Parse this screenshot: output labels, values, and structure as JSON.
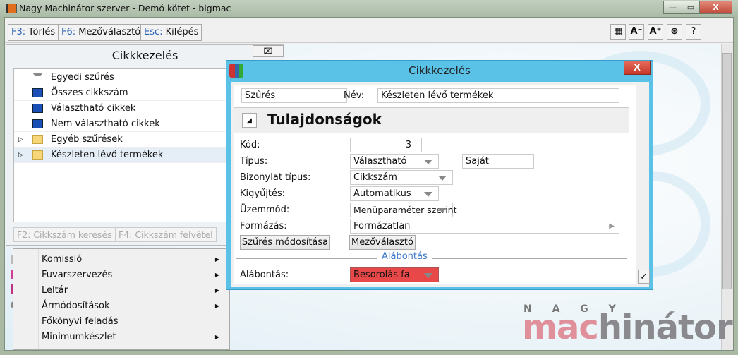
{
  "window": {
    "title": "Nagy Machinátor szerver - Demó kötet - bigmac",
    "minimize": "—",
    "maximize": "▭",
    "close": "X"
  },
  "toolbar": {
    "buttons": [
      {
        "key": "F3:",
        "label": " Törlés"
      },
      {
        "key": "F6:",
        "label": " Mezőválasztó"
      },
      {
        "key": "Esc:",
        "label": " Kilépés"
      }
    ],
    "icons": {
      "grid": "▦",
      "font_smaller": "A⁻",
      "font_larger": "A⁺",
      "lifebuoy": "⊕",
      "help": "?"
    }
  },
  "left_panel": {
    "title": "Cikkkezelés",
    "close": "⌧",
    "items": [
      {
        "label": "Egyedi szűrés",
        "icon": "filter-icon"
      },
      {
        "label": "Összes cikkszám",
        "icon": "monitor-icon"
      },
      {
        "label": "Választható cikkek",
        "icon": "monitor-icon"
      },
      {
        "label": "Nem választható cikkek",
        "icon": "monitor-icon"
      },
      {
        "label": "Egyéb szűrések",
        "icon": "folder-icon"
      },
      {
        "label": "Készleten lévő termékek",
        "icon": "folder-icon"
      }
    ],
    "search_button": "F2: Cikkszám keresés",
    "add_button": "F4: Cikkszám felvétel"
  },
  "menu": {
    "items": [
      {
        "label": "Komissió",
        "arrow": "▶"
      },
      {
        "label": "Fuvarszervezés",
        "arrow": "▶"
      },
      {
        "label": "Leltár",
        "arrow": "▶"
      },
      {
        "label": "Ármódosítások",
        "arrow": "▶"
      },
      {
        "label": "Főkönyvi feladás",
        "arrow": ""
      },
      {
        "label": "Minimumkészlet",
        "arrow": "▶"
      }
    ]
  },
  "dialog": {
    "title": "Cikkkezelés",
    "close": "X",
    "type_field": "Szűrés",
    "name_label": "Név:",
    "name_value": "Készleten lévő termékek",
    "section_title": "Tulajdonságok",
    "collapse": "◢",
    "kod_label": "Kód:",
    "kod_value": "3",
    "tipus_label": "Típus:",
    "tipus_value": "Választható",
    "tipus_extra": "Saját",
    "bizonylat_label": "Bizonylat típus:",
    "bizonylat_value": "Cikkszám",
    "kigyujtes_label": "Kigyűjtés:",
    "kigyujtes_value": "Automatikus",
    "uzemmod_label": "Üzemmód:",
    "uzemmod_value": "Menüparaméter szerint",
    "formazas_label": "Formázás:",
    "formazas_value": "Formázatlan",
    "formazas_arrow": "▶",
    "modify_button": "Szűrés módosítása",
    "field_picker_button": "Mezőválasztó",
    "group_title": "Alábontás",
    "alabontas_label": "Alábontás:",
    "alabontas_value": "Besorolás fa",
    "ok": "✓",
    "alert_color": "#e84848"
  },
  "logo": {
    "top": "N A G Y",
    "part1": "mac",
    "part2": "hinátor"
  }
}
